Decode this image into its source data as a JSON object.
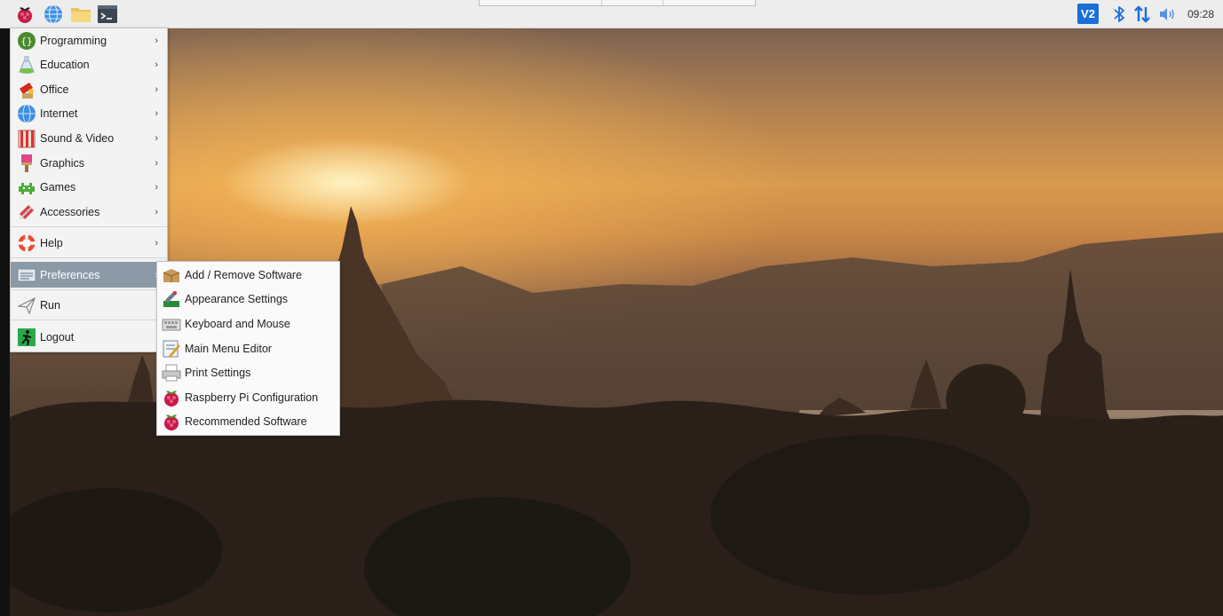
{
  "panel": {
    "launchers": [
      {
        "name": "raspberry-menu-icon"
      },
      {
        "name": "web-browser-icon"
      },
      {
        "name": "file-manager-icon"
      },
      {
        "name": "terminal-icon"
      }
    ],
    "tray": {
      "vnc_label": "V2",
      "clock": "09:28"
    }
  },
  "main_menu": {
    "items": [
      {
        "label": "Programming",
        "icon": "programming-icon"
      },
      {
        "label": "Education",
        "icon": "education-icon"
      },
      {
        "label": "Office",
        "icon": "office-icon"
      },
      {
        "label": "Internet",
        "icon": "internet-icon"
      },
      {
        "label": "Sound & Video",
        "icon": "sound-video-icon"
      },
      {
        "label": "Graphics",
        "icon": "graphics-icon"
      },
      {
        "label": "Games",
        "icon": "games-icon"
      },
      {
        "label": "Accessories",
        "icon": "accessories-icon"
      },
      {
        "label": "Help",
        "icon": "help-icon"
      },
      {
        "label": "Preferences",
        "icon": "preferences-icon",
        "selected": true
      },
      {
        "label": "Run",
        "icon": "run-icon"
      },
      {
        "label": "Logout",
        "icon": "logout-icon"
      }
    ],
    "submenu_arrow": "›"
  },
  "preferences_menu": {
    "items": [
      {
        "label": "Add / Remove Software",
        "icon": "package-icon"
      },
      {
        "label": "Appearance Settings",
        "icon": "appearance-icon"
      },
      {
        "label": "Keyboard and Mouse",
        "icon": "keyboard-mouse-icon"
      },
      {
        "label": "Main Menu Editor",
        "icon": "menu-editor-icon"
      },
      {
        "label": "Print Settings",
        "icon": "printer-icon"
      },
      {
        "label": "Raspberry Pi Configuration",
        "icon": "raspberry-icon"
      },
      {
        "label": "Recommended Software",
        "icon": "raspberry-icon"
      }
    ]
  },
  "colors": {
    "panel_bg": "#ededed",
    "menu_bg": "#f3f3f3",
    "selected_bg": "#8c9aa8",
    "tray_blue": "#1a6fd8"
  }
}
